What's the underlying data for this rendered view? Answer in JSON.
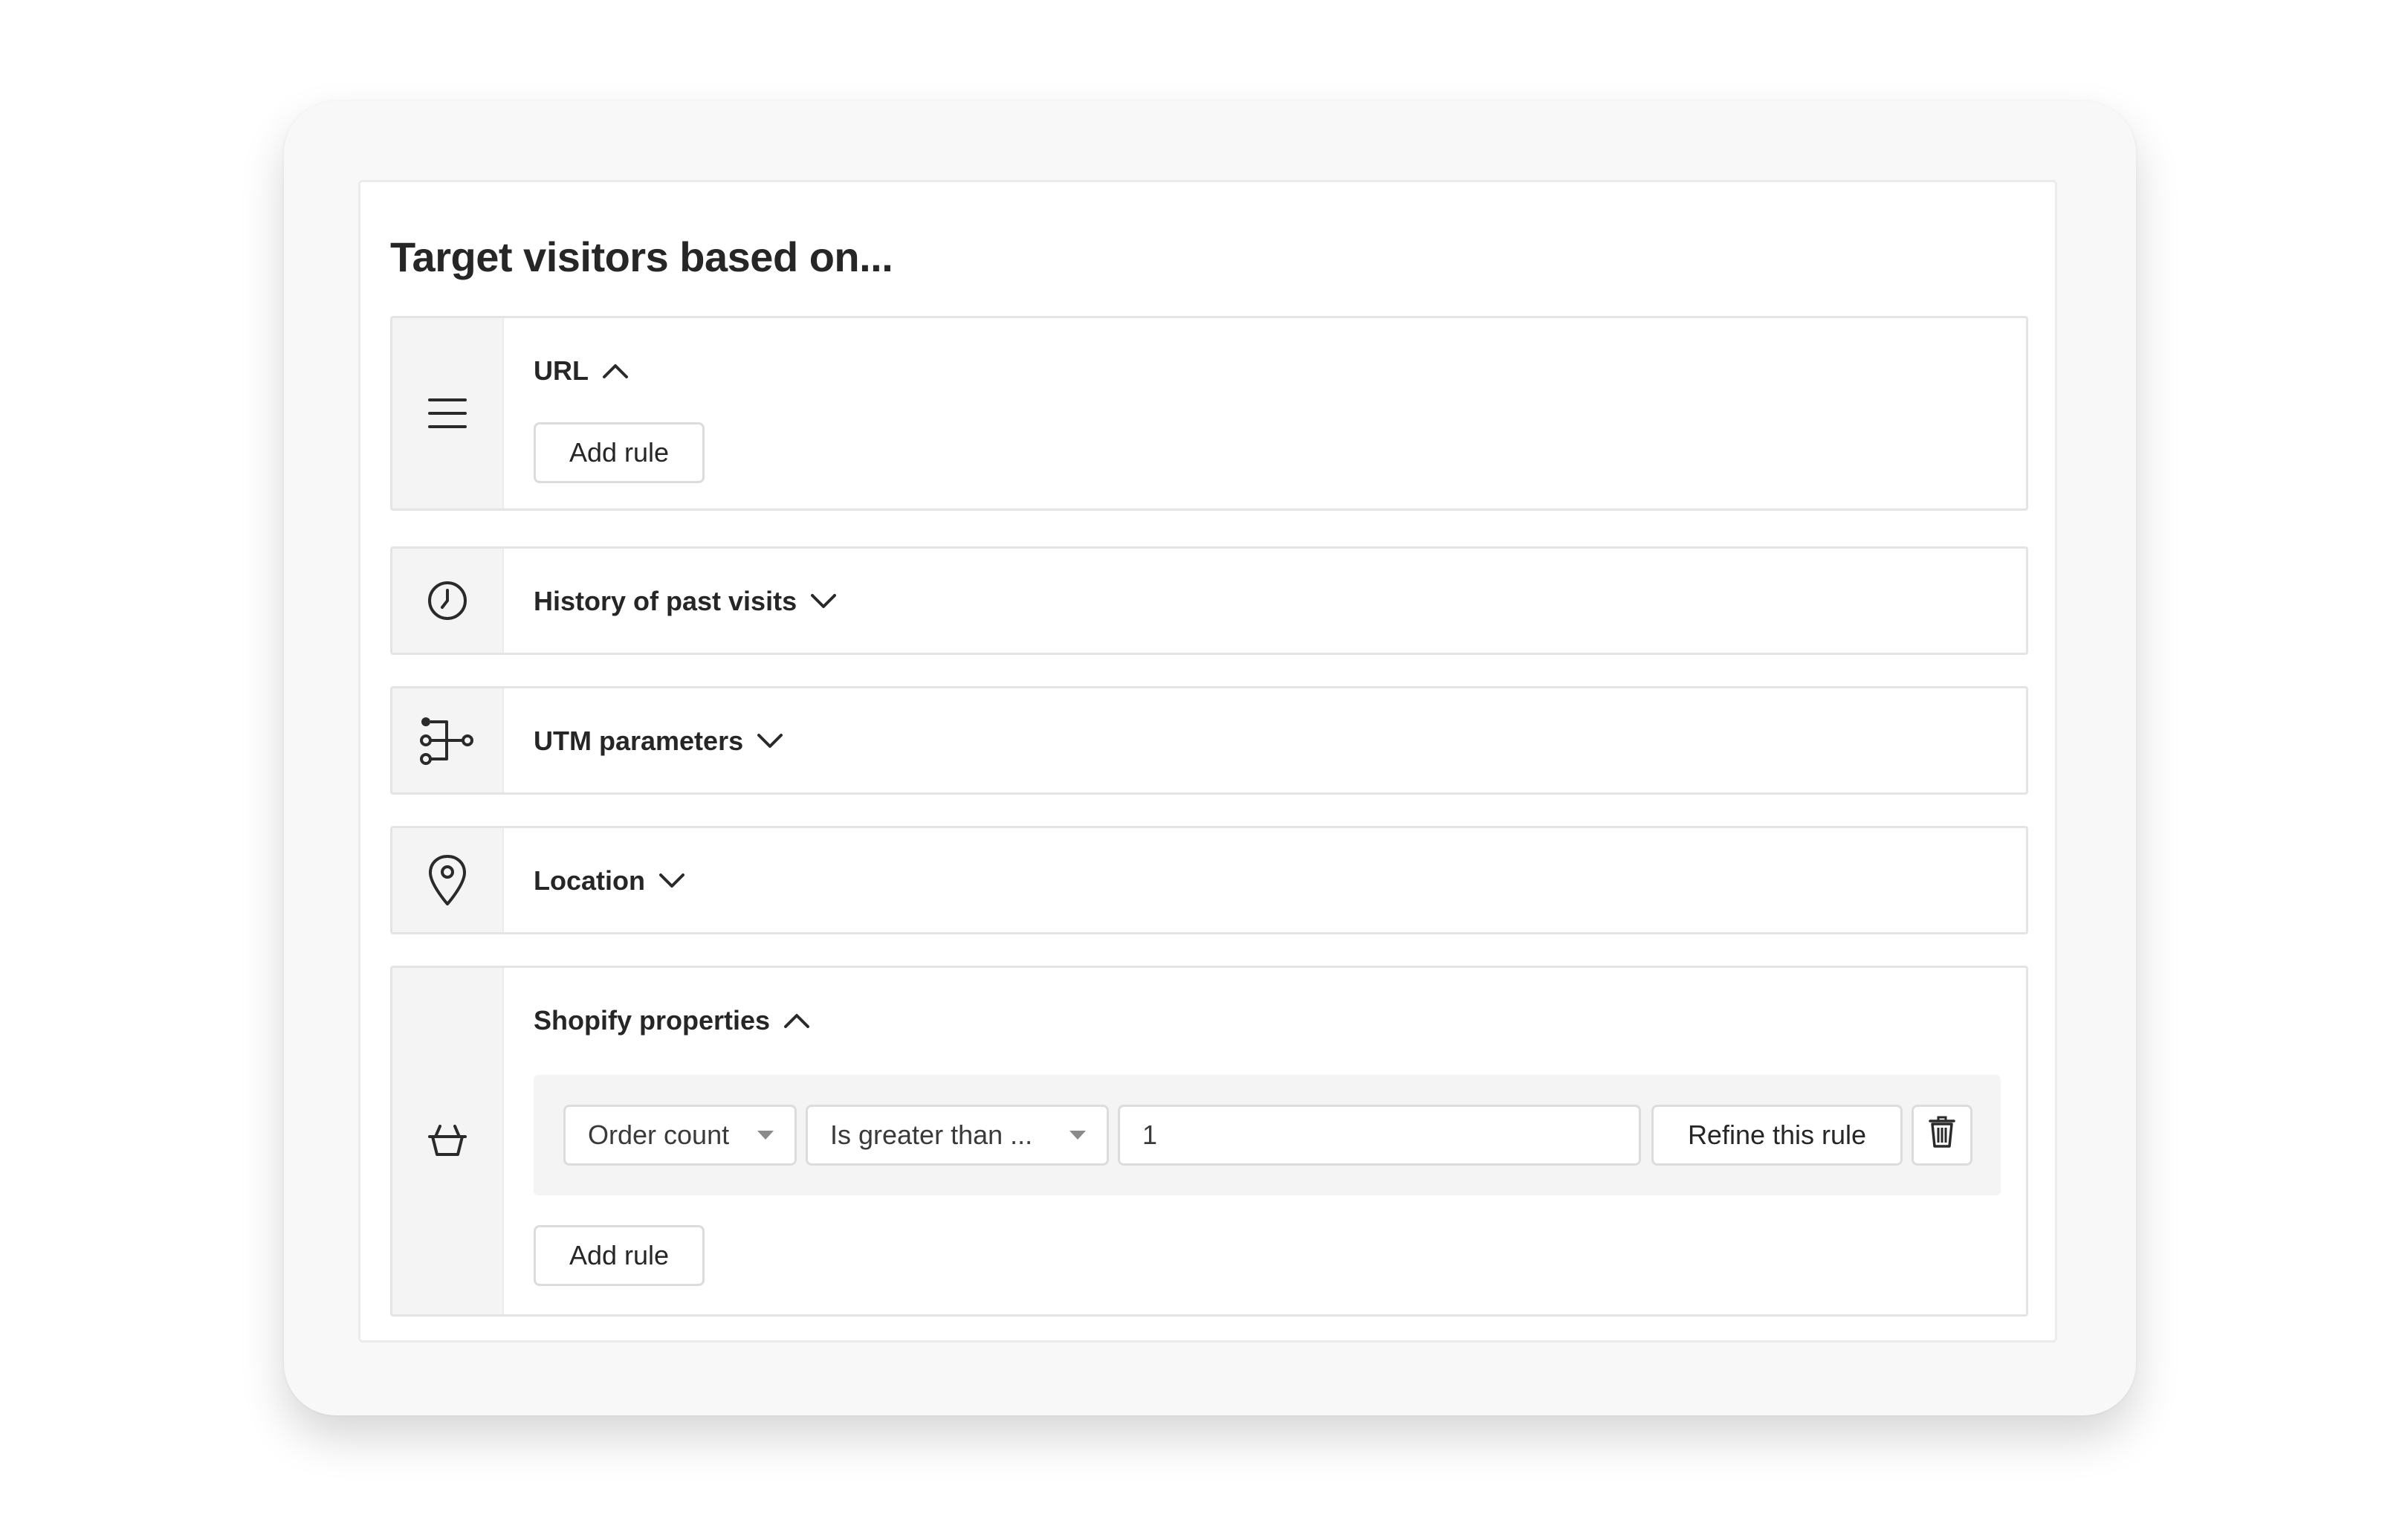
{
  "panel": {
    "title": "Target visitors based on..."
  },
  "sections": {
    "url": {
      "title": "URL",
      "icon": "menu-lines-icon",
      "expanded": true,
      "add_rule_label": "Add rule"
    },
    "history": {
      "title": "History of past visits",
      "icon": "clock-icon",
      "expanded": false
    },
    "utm": {
      "title": "UTM parameters",
      "icon": "branch-icon",
      "expanded": false
    },
    "location": {
      "title": "Location",
      "icon": "map-pin-icon",
      "expanded": false
    },
    "shopify": {
      "title": "Shopify properties",
      "icon": "basket-icon",
      "expanded": true,
      "rule": {
        "property": "Order count",
        "operator": "Is greater than ...",
        "value": "1",
        "refine_label": "Refine this rule",
        "delete_icon": "trash-icon"
      },
      "add_rule_label": "Add rule"
    }
  },
  "colors": {
    "icon_col_bg": "#f4f4f4",
    "border": "#e4e4e4",
    "text": "#262626"
  }
}
